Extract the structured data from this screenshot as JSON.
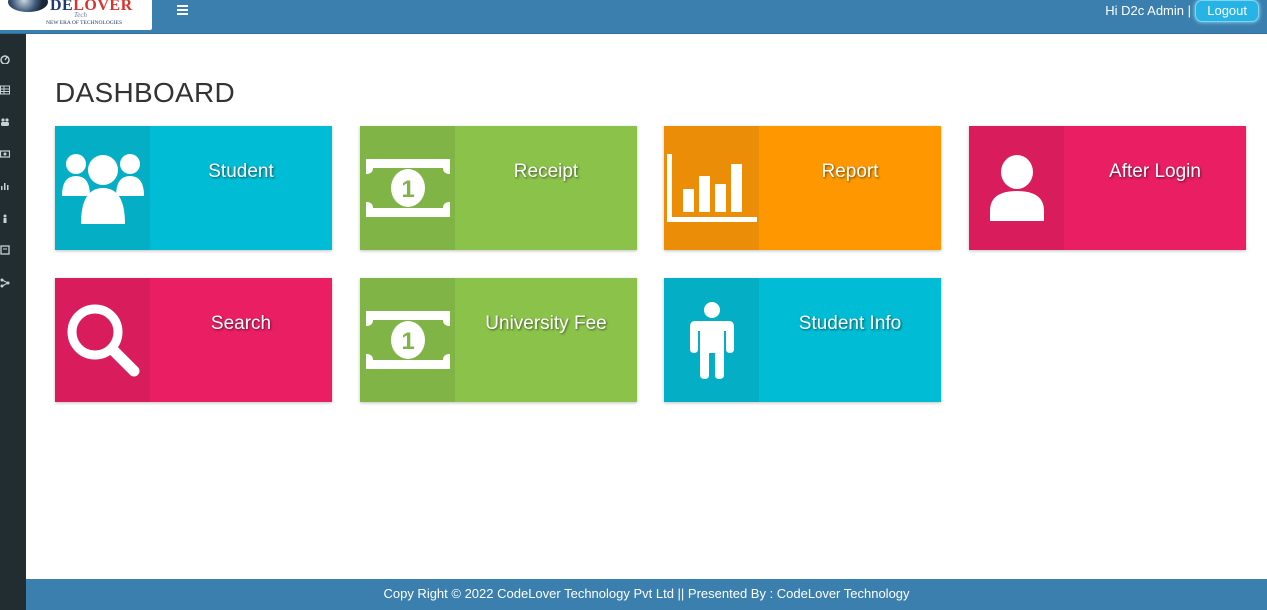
{
  "header": {
    "logo": {
      "text_a": "C",
      "text_b": "DE",
      "text_c": "LOVER",
      "tagline": "Tech",
      "subtitle": "NEW ERA OF TECHNOLOGIES"
    },
    "greeting": "Hi D2c Admin |",
    "logout_label": "Logout"
  },
  "sidebar": {
    "icons": [
      "dashboard-icon",
      "table-icon",
      "users-icon",
      "money-icon",
      "bar-chart-icon",
      "user-icon",
      "book-icon",
      "sitemap-icon"
    ]
  },
  "main": {
    "title": "DASHBOARD",
    "tiles": [
      {
        "label": "Student",
        "icon": "users-group-icon",
        "color": "#00bcd4",
        "icon_bg": "#04aec5"
      },
      {
        "label": "Receipt",
        "icon": "money-bill-icon",
        "color": "#8bc34a",
        "icon_bg": "#81b446"
      },
      {
        "label": "Report",
        "icon": "bar-chart-icon",
        "color": "#ff9800",
        "icon_bg": "#ec8d07"
      },
      {
        "label": "After Login",
        "icon": "user-icon",
        "color": "#e91e63",
        "icon_bg": "#d81c5c"
      },
      {
        "label": "Search",
        "icon": "search-icon",
        "color": "#e91e63",
        "icon_bg": "#d81c5c"
      },
      {
        "label": "University Fee",
        "icon": "money-bill-icon",
        "color": "#8bc34a",
        "icon_bg": "#81b446"
      },
      {
        "label": "Student Info",
        "icon": "male-icon",
        "color": "#00bcd4",
        "icon_bg": "#04aec5"
      }
    ]
  },
  "footer": {
    "text": "Copy Right © 2022 CodeLover Technology Pvt Ltd || Presented By : CodeLover Technology"
  }
}
